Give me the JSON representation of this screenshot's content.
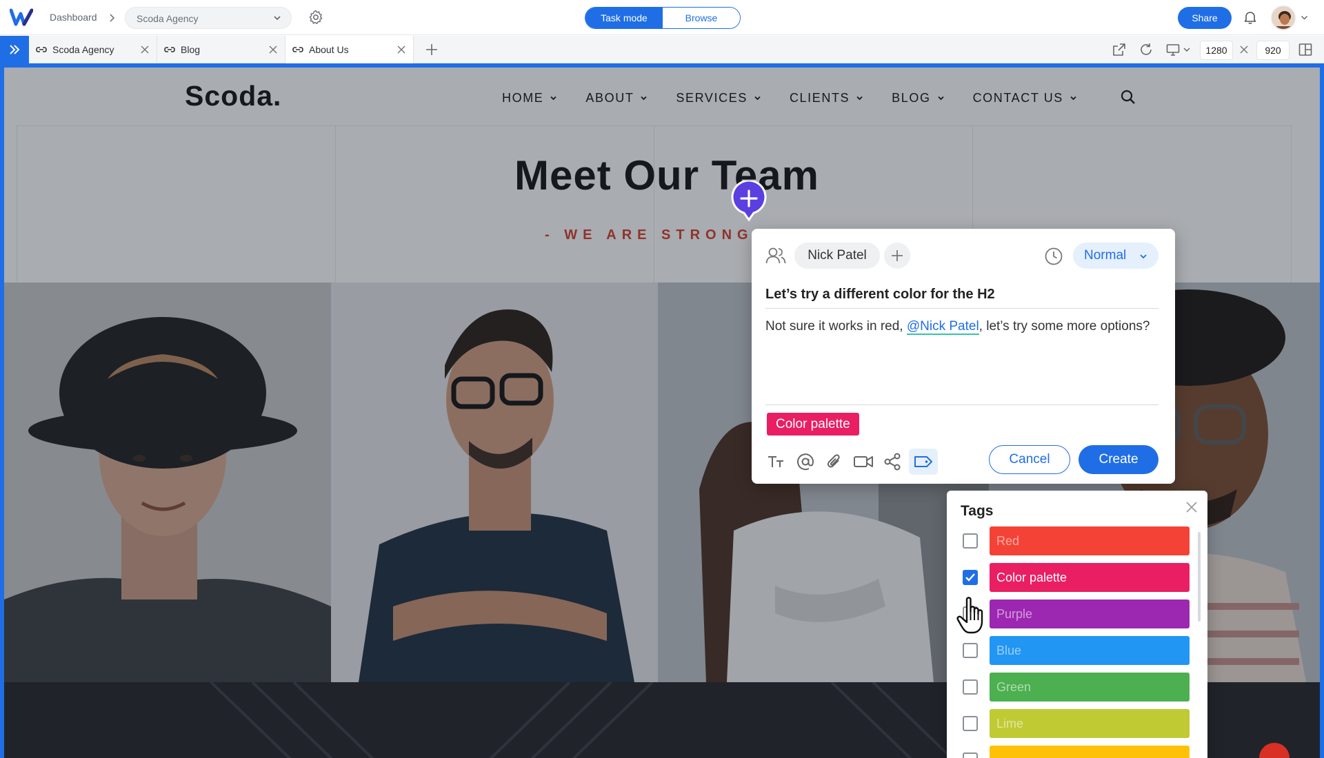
{
  "app": {
    "breadcrumb_root": "Dashboard",
    "project": "Scoda Agency",
    "mode_task": "Task mode",
    "mode_browse": "Browse",
    "share": "Share",
    "brand_color": "#1f6ee6"
  },
  "tabs": [
    {
      "label": "Scoda Agency",
      "icon": "link-icon"
    },
    {
      "label": "Blog",
      "icon": "link-icon"
    },
    {
      "label": "About Us",
      "icon": "link-icon",
      "active": true
    }
  ],
  "viewport": {
    "width": "1280",
    "height": "920"
  },
  "site": {
    "logo": "Scoda.",
    "nav": [
      "HOME",
      "ABOUT",
      "SERVICES",
      "CLIENTS",
      "BLOG",
      "CONTACT US"
    ],
    "hero_title": "Meet Our Team",
    "hero_subtitle": "- WE ARE STRONGER"
  },
  "task": {
    "assignee": "Nick Patel",
    "priority": "Normal",
    "title": "Let’s  try a different color for the H2",
    "desc_before": "Not sure it works in red, ",
    "mention": "@Nick Patel",
    "desc_after": ", let’s try some more options?",
    "applied_tag": "Color palette",
    "applied_tag_color": "#e91e63",
    "tools": [
      "text-format-icon",
      "mention-icon",
      "attachment-icon",
      "video-icon",
      "share-icon",
      "tag-icon"
    ],
    "cancel": "Cancel",
    "create": "Create"
  },
  "tags": {
    "title": "Tags",
    "items": [
      {
        "label": "Red",
        "color": "#f44336",
        "checked": false
      },
      {
        "label": "Color palette",
        "color": "#e91e63",
        "checked": true
      },
      {
        "label": "Purple",
        "color": "#9c27b0",
        "checked": false
      },
      {
        "label": "Blue",
        "color": "#2196f3",
        "checked": false
      },
      {
        "label": "Green",
        "color": "#4caf50",
        "checked": false
      },
      {
        "label": "Lime",
        "color": "#c0ca33",
        "checked": false
      },
      {
        "label": "",
        "color": "#ffc107",
        "checked": false
      }
    ]
  }
}
